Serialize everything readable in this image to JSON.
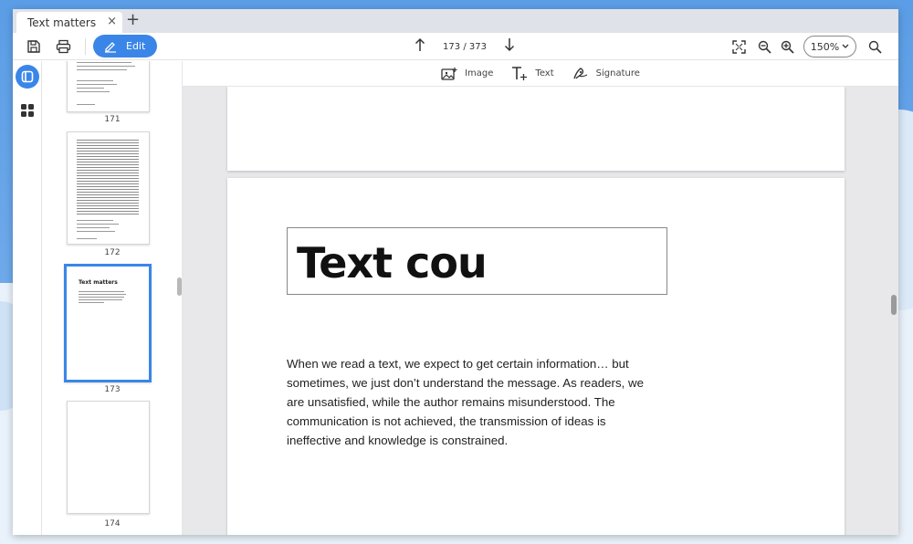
{
  "tab": {
    "title": "Text matters",
    "close": "×",
    "new": "+"
  },
  "toolbar": {
    "edit_label": "Edit",
    "page_indicator": "173 / 373",
    "zoom_value": "150%"
  },
  "subtoolbar": {
    "image_label": "Image",
    "text_label": "Text",
    "signature_label": "Signature"
  },
  "thumbnails": [
    {
      "number": "171"
    },
    {
      "number": "172"
    },
    {
      "number": "173",
      "heading": "Text matters",
      "active": true
    },
    {
      "number": "174"
    }
  ],
  "document": {
    "title_text": "Text cou",
    "body": "When we read a text, we expect to get certain information… but sometimes, we just don’t understand the message. As readers, we are unsatisfied, while the author remains misunderstood. The communication is not achieved, the transmission of ideas is ineffective and knowledge is constrained."
  },
  "colors": {
    "accent": "#3a86e8",
    "background_top": "#5b9de6"
  }
}
